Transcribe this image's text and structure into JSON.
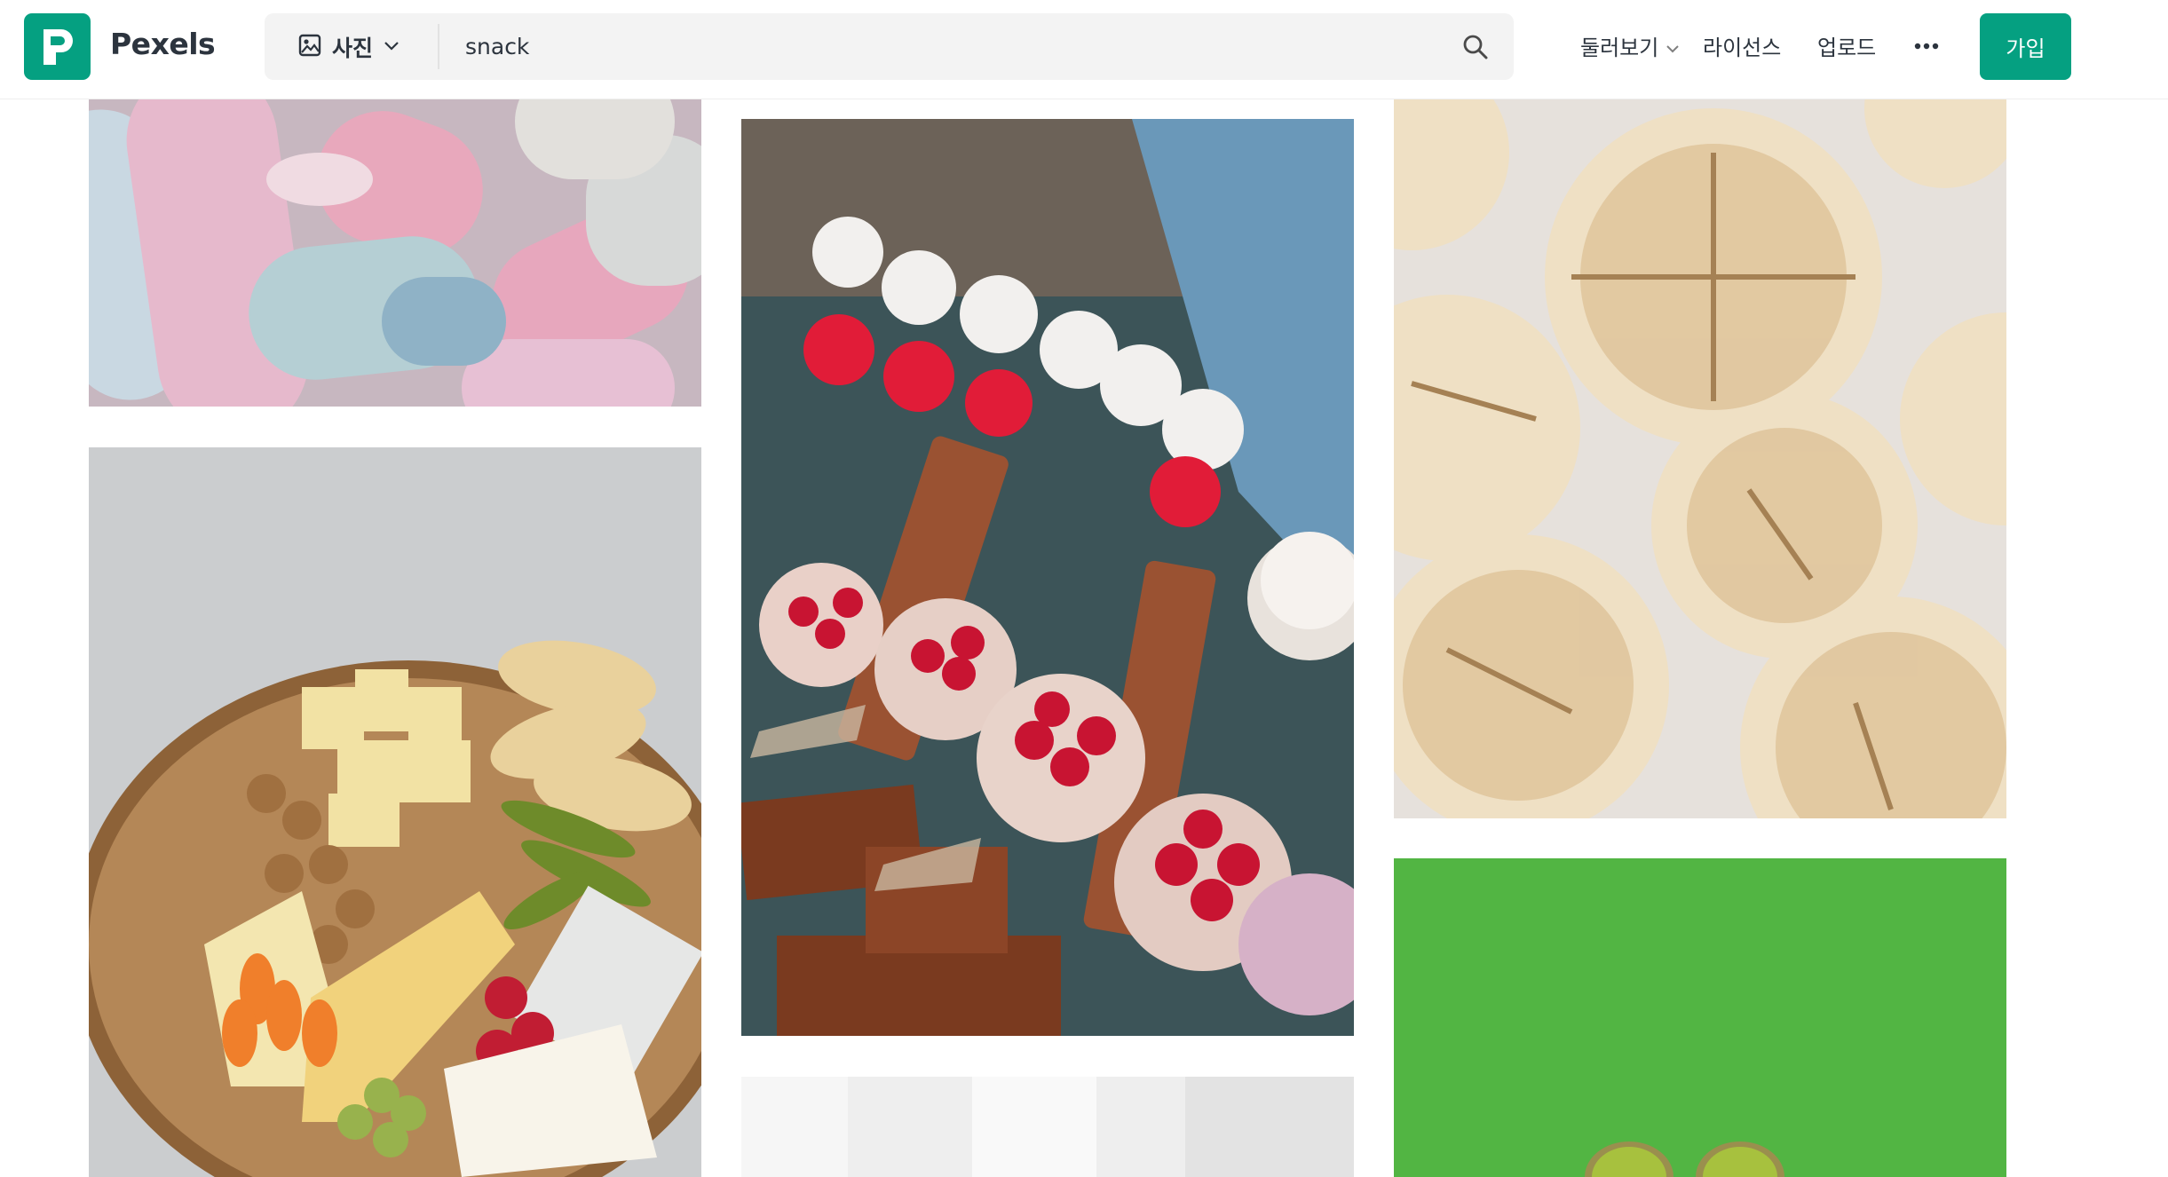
{
  "header": {
    "brand": "Pexels",
    "search": {
      "type_label": "사진",
      "query": "snack",
      "placeholder": "snack"
    },
    "nav": {
      "explore": "둘러보기",
      "license": "라이선스",
      "upload": "업로드",
      "join": "가입"
    }
  },
  "colors": {
    "brand": "#05a081",
    "text": "#2c343e",
    "search_bg": "#f3f3f3"
  },
  "icons": [
    "pexels-logo-icon",
    "image-icon",
    "chevron-down-icon",
    "search-icon",
    "more-icon"
  ],
  "gallery": {
    "photos": [
      "pastel-candies",
      "pastry-display",
      "bread-rolls",
      "cheese-board",
      "white-drape",
      "kiwi-green"
    ]
  }
}
